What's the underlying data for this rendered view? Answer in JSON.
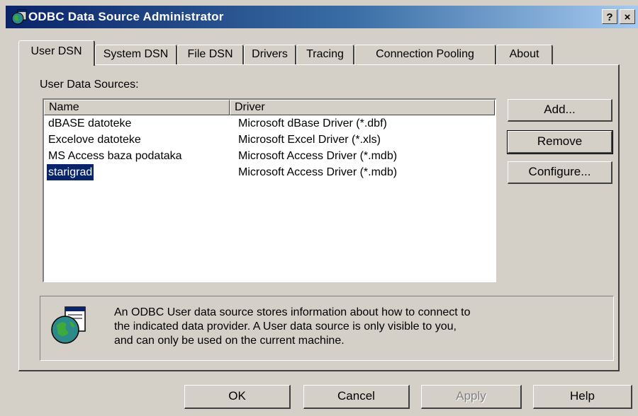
{
  "window": {
    "title": "ODBC Data Source Administrator",
    "help_button": "?",
    "close_button": "×",
    "app_icon": "odbc-globe-icon"
  },
  "tabs": [
    {
      "label": "User DSN",
      "active": true
    },
    {
      "label": "System DSN",
      "active": false
    },
    {
      "label": "File DSN",
      "active": false
    },
    {
      "label": "Drivers",
      "active": false
    },
    {
      "label": "Tracing",
      "active": false
    },
    {
      "label": "Connection Pooling",
      "active": false
    },
    {
      "label": "About",
      "active": false
    }
  ],
  "user_dsn": {
    "group_label": "User Data Sources:",
    "columns": {
      "name": "Name",
      "driver": "Driver"
    },
    "rows": [
      {
        "name": "dBASE datoteke",
        "driver": "Microsoft dBase Driver (*.dbf)"
      },
      {
        "name": "Excelove datoteke",
        "driver": "Microsoft Excel Driver (*.xls)"
      },
      {
        "name": "MS Access baza podataka",
        "driver": "Microsoft Access Driver (*.mdb)"
      },
      {
        "name": "starigrad",
        "driver": "Microsoft Access Driver (*.mdb)",
        "selected": true
      }
    ],
    "buttons": {
      "add": "Add...",
      "remove": "Remove",
      "configure": "Configure..."
    },
    "info": {
      "icon": "odbc-globe-icon",
      "line1": "An ODBC User data source stores information about how to connect to",
      "line2": "the indicated data provider.   A User data source is only visible to you,",
      "line3": "and can only be used on the current machine."
    }
  },
  "footer": {
    "ok": "OK",
    "cancel": "Cancel",
    "apply": "Apply",
    "help": "Help"
  },
  "colors": {
    "face": "#d4d0c8",
    "title_active": "#0a246a",
    "selection": "#0a246a"
  }
}
